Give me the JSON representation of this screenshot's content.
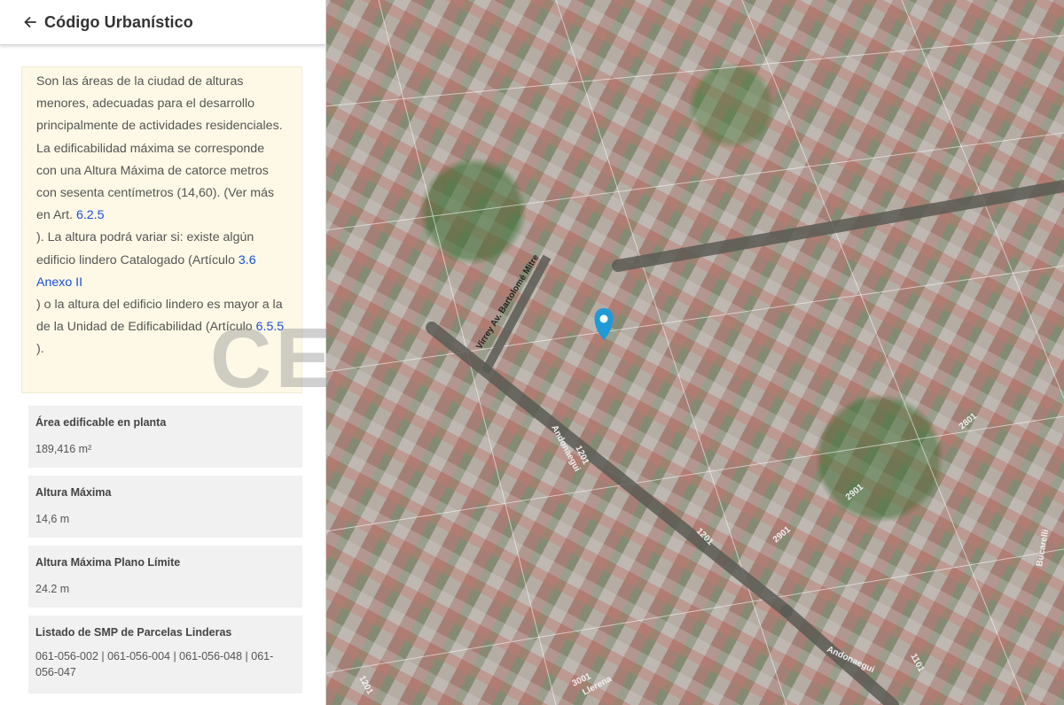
{
  "header": {
    "title": "Código Urbanístico"
  },
  "description": {
    "text_1": "Son las áreas de la ciudad de alturas menores, adecuadas para el desarrollo principalmente de actividades residenciales. La edificabilidad máxima se corresponde con una Altura Máxima de catorce metros con sesenta centímetros (14,60). (Ver más en Art. ",
    "link_1": "6.2.5",
    "text_2": "). La altura podrá variar si: existe algún edificio lindero Catalogado (Artículo ",
    "link_2": "3.6 Anexo II",
    "text_3": ") o la altura del edificio lindero es mayor a la de la Unidad de Edificabilidad (Artículo ",
    "link_3": "6.5.5",
    "text_4": ")."
  },
  "cards": [
    {
      "label": "Área edificable en planta",
      "value": "189,416 m²"
    },
    {
      "label": "Altura Máxima",
      "value": "14,6 m"
    },
    {
      "label": "Altura Máxima Plano Límite",
      "value": "24.2 m"
    },
    {
      "label": "Listado de SMP de Parcelas Linderas",
      "value": "061-056-002 | 061-056-004 | 061-056-048 | 061-056-047"
    }
  ],
  "watermark": "CE",
  "map": {
    "streets": {
      "main": "Andonaegui",
      "cross": "Llerena",
      "diagonal": "Virrey Av. Bartolomé Mitre",
      "side": "Bucarelli"
    },
    "numbers": [
      "1201",
      "1201",
      "2901",
      "2901",
      "3001",
      "1101",
      "2801",
      "1201"
    ],
    "pin_color": "#1e9bd6"
  }
}
